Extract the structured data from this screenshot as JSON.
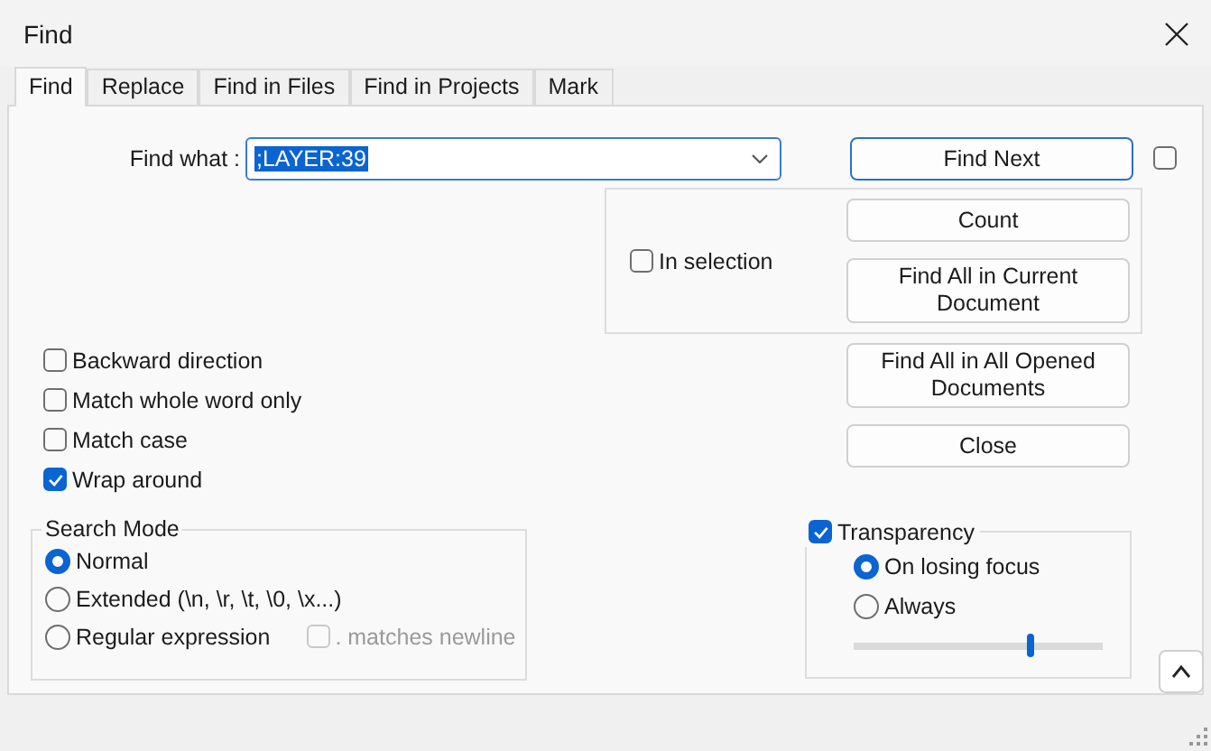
{
  "window": {
    "title": "Find"
  },
  "tabs": [
    {
      "label": "Find",
      "selected": true
    },
    {
      "label": "Replace",
      "selected": false
    },
    {
      "label": "Find in Files",
      "selected": false
    },
    {
      "label": "Find in Projects",
      "selected": false
    },
    {
      "label": "Mark",
      "selected": false
    }
  ],
  "find_what": {
    "label": "Find what :",
    "value": ";LAYER:39"
  },
  "find_next": {
    "label": "Find Next",
    "kind": "primary"
  },
  "side_checkbox": {
    "checked": false
  },
  "in_selection": {
    "label": "In selection",
    "checked": false
  },
  "group_buttons": [
    {
      "label": "Count"
    },
    {
      "label": "Find All in Current Document"
    }
  ],
  "other_buttons": [
    {
      "label": "Find All in All Opened Documents"
    },
    {
      "label": "Close"
    }
  ],
  "options": [
    {
      "label": "Backward direction",
      "checked": false
    },
    {
      "label": "Match whole word only",
      "checked": false
    },
    {
      "label": "Match case",
      "checked": false
    },
    {
      "label": "Wrap around",
      "checked": true
    }
  ],
  "search_mode": {
    "title": "Search Mode",
    "options": [
      {
        "label": "Normal",
        "selected": true
      },
      {
        "label": "Extended (\\n, \\r, \\t, \\0, \\x...)",
        "selected": false
      },
      {
        "label": "Regular expression",
        "selected": false
      }
    ],
    "matches_newline": {
      "label": ". matches newline",
      "checked": false,
      "disabled": true
    }
  },
  "transparency": {
    "label": "Transparency",
    "checked": true,
    "options": [
      {
        "label": "On losing focus",
        "selected": true
      },
      {
        "label": "Always",
        "selected": false
      }
    ],
    "slider": {
      "level": 0.71
    }
  }
}
